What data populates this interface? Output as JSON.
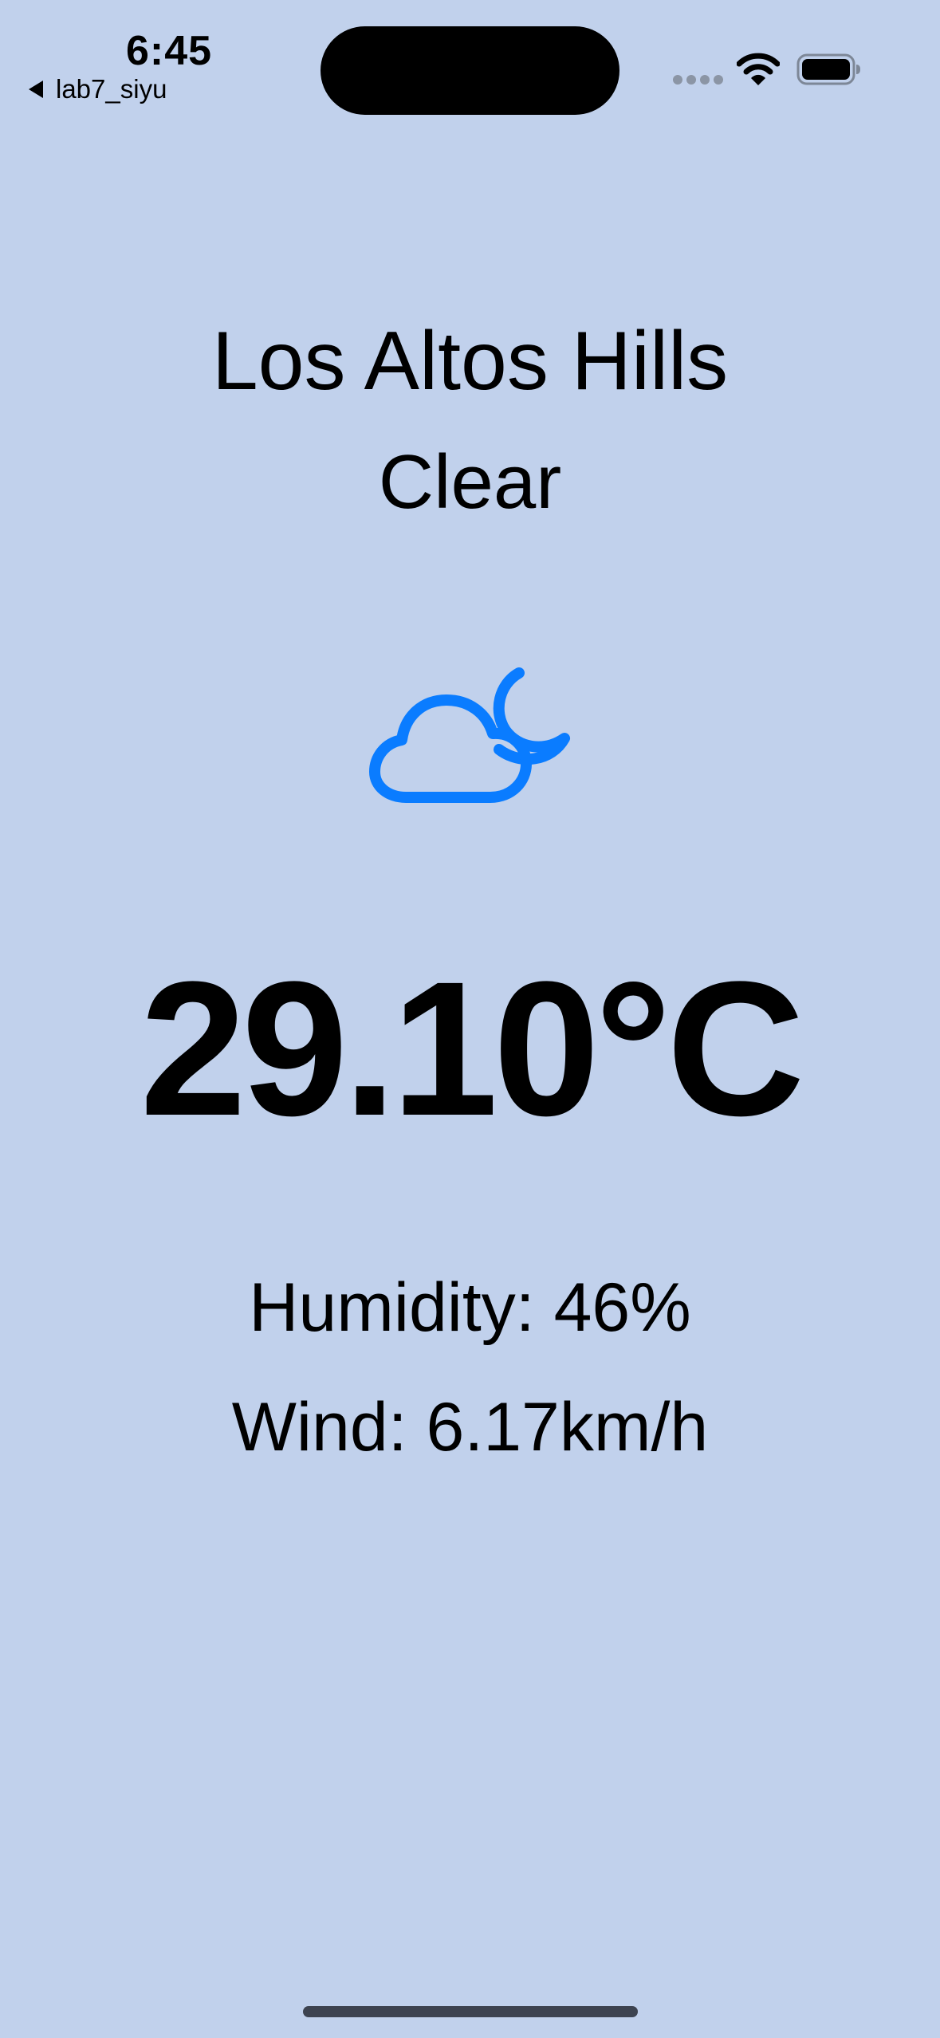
{
  "status_bar": {
    "time": "6:45",
    "back_app_label": "lab7_siyu",
    "wifi_icon": "wifi-icon",
    "battery_icon": "battery-icon"
  },
  "weather": {
    "city": "Los Altos Hills",
    "condition": "Clear",
    "icon": "cloud-moon-icon",
    "temperature": "29.10°C",
    "humidity": "Humidity: 46%",
    "wind": "Wind: 6.17km/h"
  },
  "colors": {
    "background": "#c1d1ec",
    "icon_accent": "#0a7cff",
    "text": "#000000"
  }
}
